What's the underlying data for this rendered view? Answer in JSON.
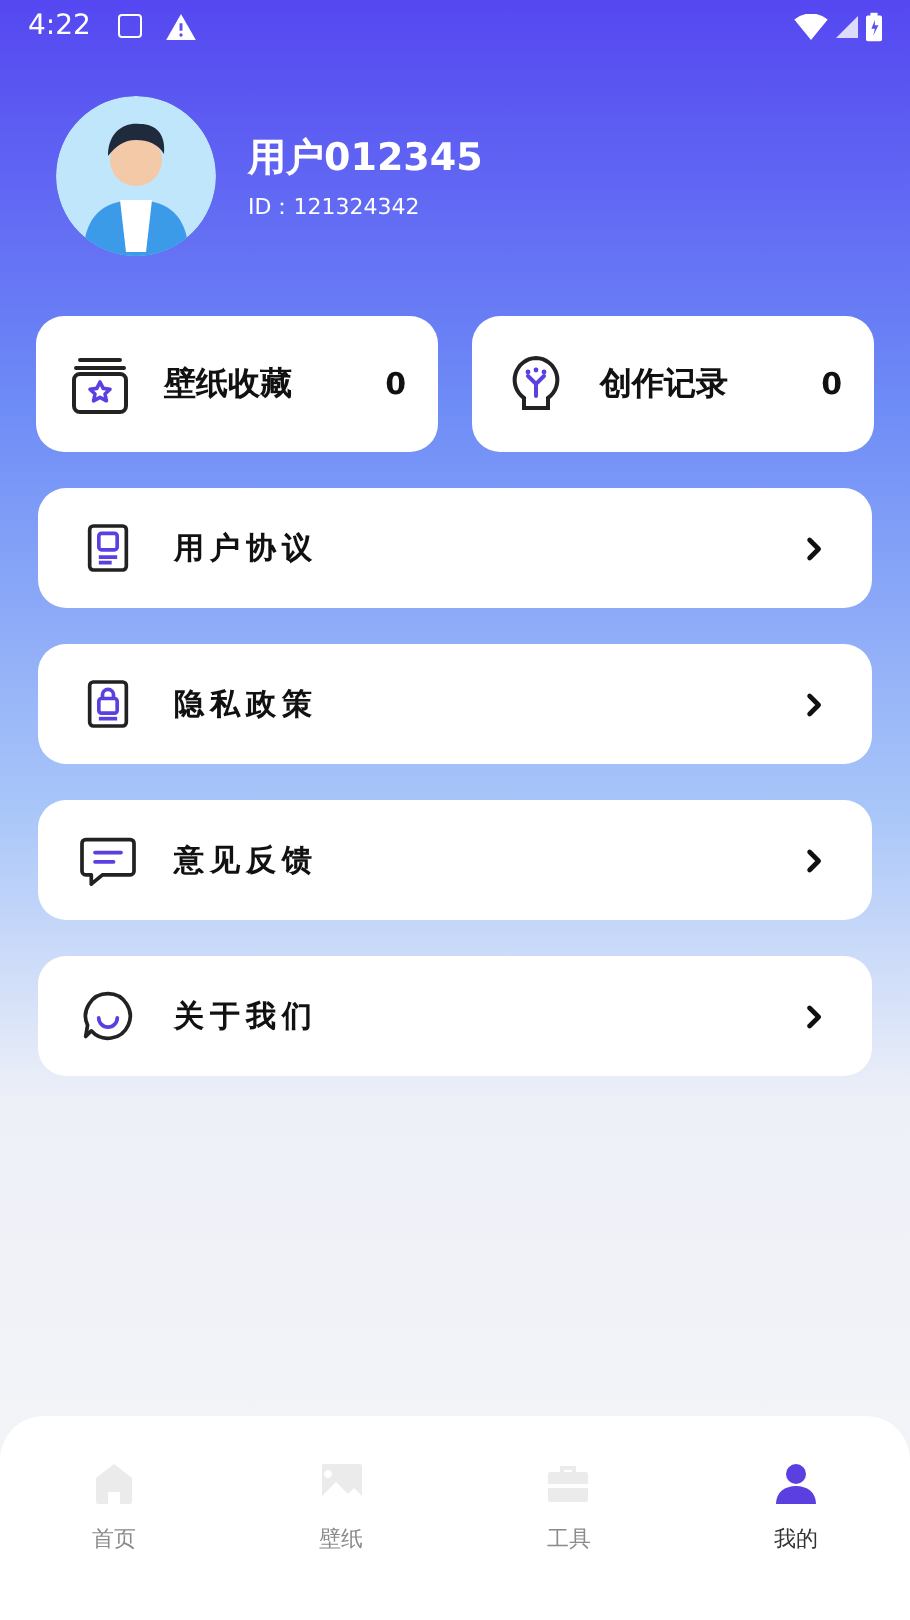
{
  "status_bar": {
    "time": "4:22"
  },
  "profile": {
    "name": "用户012345",
    "id": "ID：121324342"
  },
  "stats": [
    {
      "label": "壁纸收藏",
      "count": "0"
    },
    {
      "label": "创作记录",
      "count": "0"
    }
  ],
  "menu": [
    {
      "label": "用户协议"
    },
    {
      "label": "隐私政策"
    },
    {
      "label": "意见反馈"
    },
    {
      "label": "关于我们"
    }
  ],
  "nav": [
    {
      "label": "首页",
      "selected": false
    },
    {
      "label": "壁纸",
      "selected": false
    },
    {
      "label": "工具",
      "selected": false
    },
    {
      "label": "我的",
      "selected": true
    }
  ]
}
